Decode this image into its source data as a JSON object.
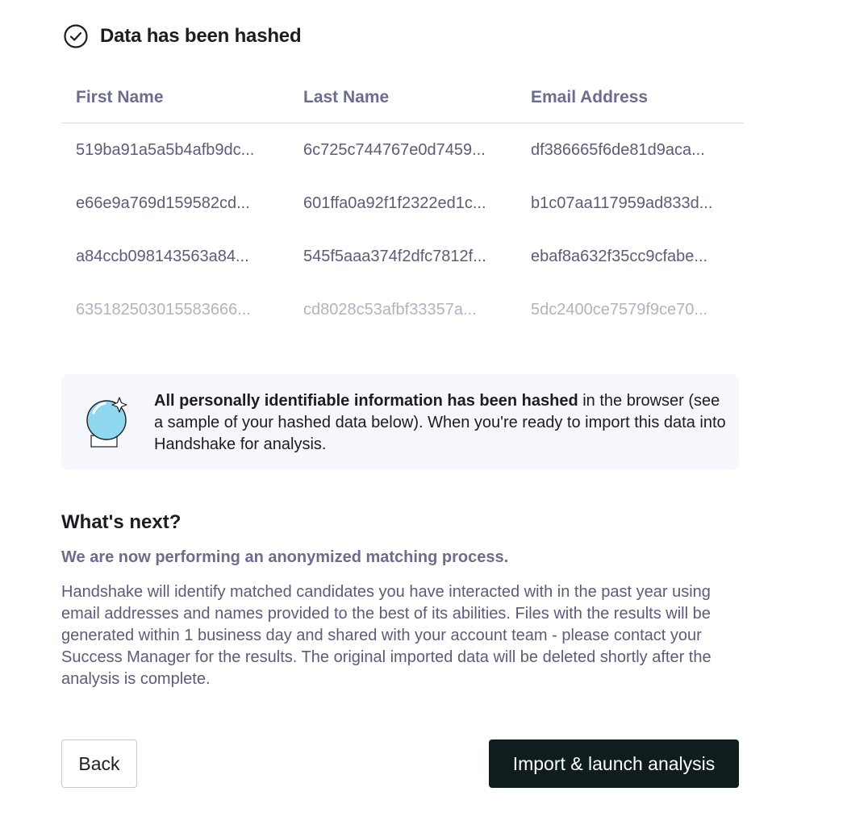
{
  "header": {
    "icon": "check-circle-icon",
    "title": "Data has been hashed"
  },
  "table": {
    "columns": [
      "First Name",
      "Last Name",
      "Email Address"
    ],
    "rows": [
      [
        "519ba91a5a5b4afb9dc...",
        "6c725c744767e0d7459...",
        "df386665f6de81d9aca..."
      ],
      [
        "e66e9a769d159582cd...",
        "601ffa0a92f1f2322ed1c...",
        "b1c07aa117959ad833d..."
      ],
      [
        "a84ccb098143563a84...",
        "545f5aaa374f2dfc7812f...",
        "ebaf8a632f35cc9cfabe..."
      ],
      [
        "635182503015583666...",
        "cd8028c53afbf33357a...",
        "5dc2400ce7579f9ce70..."
      ]
    ]
  },
  "info": {
    "illustration": "crystal-ball-icon",
    "bold_text": "All personally identifiable information has been hashed",
    "text": " in the browser (see a sample of your hashed data below). When you're ready to import this data into Handshake for analysis."
  },
  "next": {
    "title": "What's next?",
    "subtitle": "We are now performing an anonymized matching process.",
    "body": "Handshake will identify matched candidates you have interacted with in the past year using email addresses and names provided to the best of its abilities. Files with the results will be generated within 1 business day and shared with your account team - please contact your Success Manager for the results. The original imported data will be deleted shortly after the analysis is complete."
  },
  "actions": {
    "back_label": "Back",
    "import_label": "Import & launch analysis"
  },
  "colors": {
    "primary_button": "#0f1d1e",
    "info_background": "#f5f7fc",
    "muted_text": "#6c6d8c",
    "orb_fill": "#8fd8f0"
  }
}
